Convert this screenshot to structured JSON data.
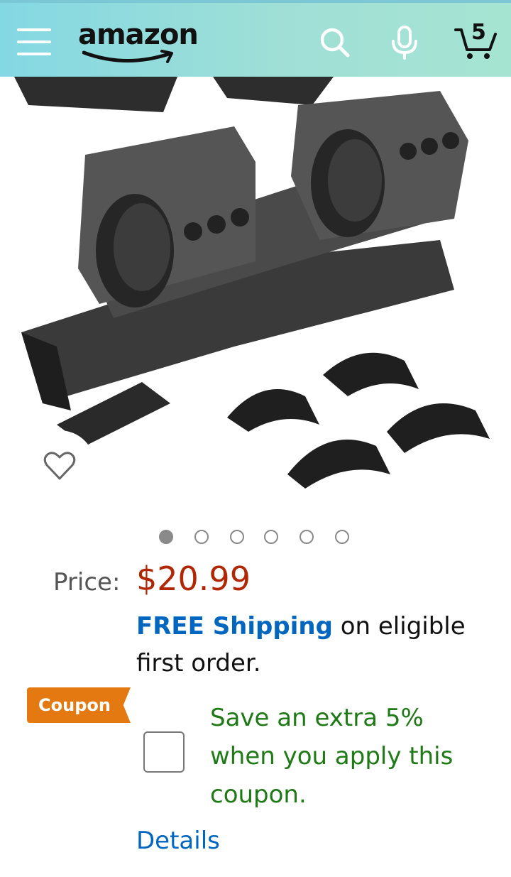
{
  "header": {
    "logo_text": "amazon",
    "cart_count": "5",
    "icons": [
      "menu-icon",
      "search-icon",
      "microphone-icon",
      "cart-icon"
    ]
  },
  "carousel": {
    "dot_count": 6,
    "active_index": 0
  },
  "price": {
    "label": "Price:",
    "value": "$20.99"
  },
  "shipping": {
    "free_label": "FREE Shipping",
    "rest": " on eligible first order."
  },
  "coupon": {
    "tag": "Coupon",
    "text": "Save an extra 5% when you apply this coupon."
  },
  "details_label": "Details",
  "colors": {
    "header_bg": "#9fdfd6",
    "price": "#b12704",
    "link": "#0066c0",
    "coupon_tag": "#e47911",
    "coupon_text": "#1e7a14"
  }
}
